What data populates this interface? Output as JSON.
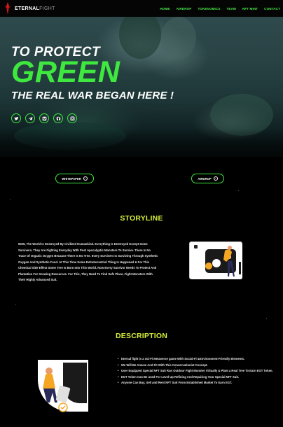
{
  "nav": {
    "logo_part1": "ETERNAL",
    "logo_part2": "FIGHT",
    "items": [
      {
        "label": "HOME"
      },
      {
        "label": "AIRDROP"
      },
      {
        "label": "TOKENOMICS"
      },
      {
        "label": "TEAM"
      },
      {
        "label": "NFT MINT"
      },
      {
        "label": "CONTACT"
      }
    ]
  },
  "hero": {
    "line1": "TO PROTECT",
    "line2": "GREEN",
    "line3": "THE REAL WAR BEGAN HERE !",
    "socials": [
      "twitter-icon",
      "telegram-icon",
      "medium-icon",
      "facebook-icon",
      "instagram-icon"
    ]
  },
  "buttons": {
    "whitepaper": "WHITEPAPER",
    "airdrop": "AIRDROP"
  },
  "storyline": {
    "title": "STORYLINE",
    "text": "5029, The World Is Destroyed By Civilized Humankind. Everything Is Destroyed Except Some Survivers. They Are Fighting Everyday With Post Apocalyptic Monsters To Survive. There Is No Trace Of Organic Oxygen Because There Is No Tree. Every Survivers Is Surviving Through Synthetic Oxygen And Synthetic Food. At This Time Some Extraterrestrial Thing Is Happened & For This Chemical Side Effect Some Tree Is Born Into This World. Now Every Survivor Needs To Protect And Plantation For Growing Resources. For This, They Need To Find Safe Place, Fight Monsters With Their Highly Advanced Suit."
  },
  "description": {
    "title": "DESCRIPTION",
    "items": [
      "Eternal fight is a Sci-Fi Metaverse game With Social-Fi &Environment-Friendly Elements.",
      "We Will Be Amuse And Fit With This Conservationist Concept.",
      "User Equipped Special NFT Suit Run Outdoor Fight Monster Virtually & Plant a Real Tree To Earn EGT Token.",
      "EGT Token Can Be used For Level Up Refining And Repairing Your Special NFT Suit.",
      "Anyone Can Buy, Sell and Rent NFT Suit From Established Market To Earn EGT."
    ]
  },
  "colors": {
    "accent_green": "#3ee83e",
    "title_yellow": "#d6ef3a",
    "nav_green": "#49f049"
  }
}
